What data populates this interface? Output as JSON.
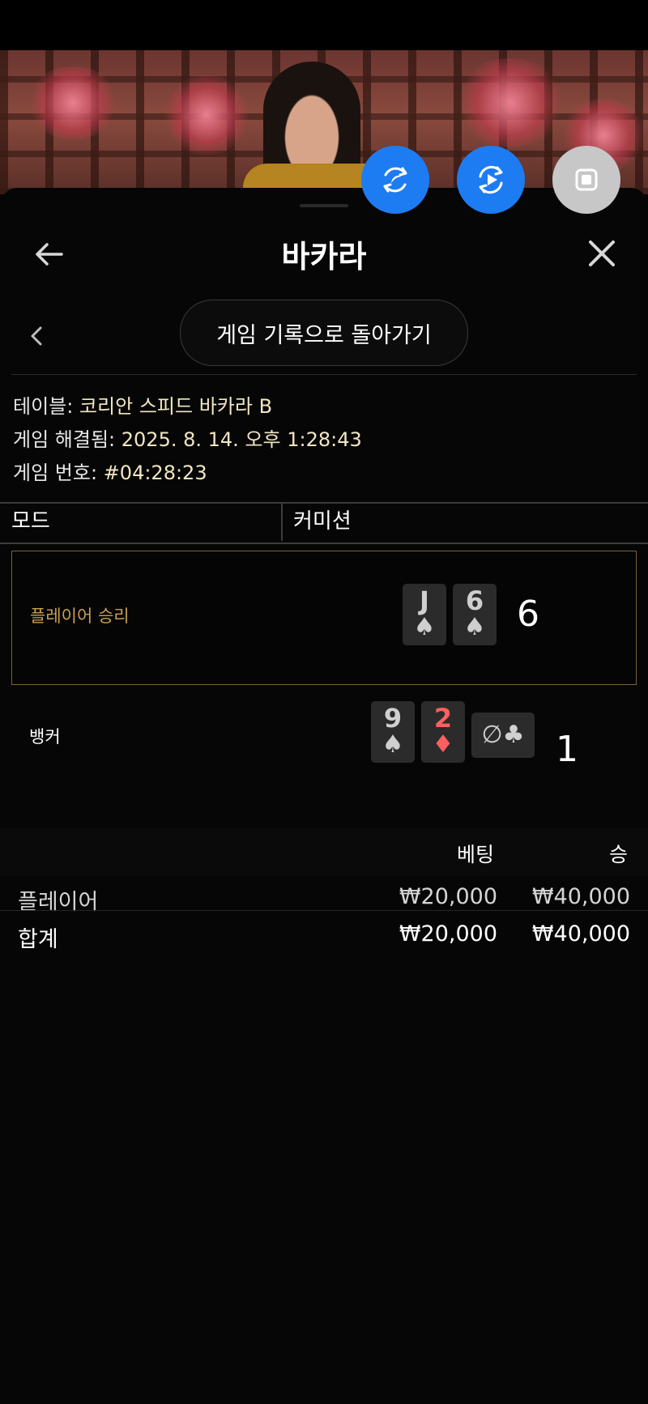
{
  "header": {
    "title": "바카라"
  },
  "nav": {
    "back_to_history": "게임 기록으로 돌아가기"
  },
  "info": {
    "table_label": "테이블:",
    "table_value": "코리안 스피드 바카라 B",
    "resolved_label": "게임 해결됨:",
    "resolved_value": "2025. 8. 14. 오후 1:28:43",
    "game_no_label": "게임 번호:",
    "game_no_value": "#04:28:23"
  },
  "mode_table": {
    "mode_header": "모드",
    "commission_header": "커미션"
  },
  "hands": {
    "player": {
      "label": "플레이어 승리",
      "label_color": "#c8a04f",
      "cards": [
        {
          "rank": "J",
          "suit": "♠"
        },
        {
          "rank": "6",
          "suit": "♠"
        }
      ],
      "score": "6"
    },
    "banker": {
      "label": "뱅커",
      "cards": [
        {
          "rank": "9",
          "suit": "♠"
        },
        {
          "rank": "2",
          "suit": "♦"
        }
      ],
      "side_card": {
        "symbol": "∅",
        "suit": "♣"
      },
      "score": "1"
    }
  },
  "bets": {
    "headers": {
      "bet": "베팅",
      "win": "승"
    },
    "rows": [
      {
        "label": "플레이어",
        "bet": "₩20,000",
        "win": "₩40,000"
      },
      {
        "label": "합계",
        "bet": "₩20,000",
        "win": "₩40,000"
      }
    ]
  },
  "icons": {
    "fab1": "rotate-sync-icon",
    "fab2": "replay-play-icon",
    "fab3": "stop-square-icon",
    "back": "arrow-left-icon",
    "close": "close-icon",
    "prev": "chevron-left-icon"
  },
  "colors": {
    "accent_blue": "#1e7cf2",
    "gold_border": "#7a6438",
    "red_suit": "#ff5f5f"
  }
}
